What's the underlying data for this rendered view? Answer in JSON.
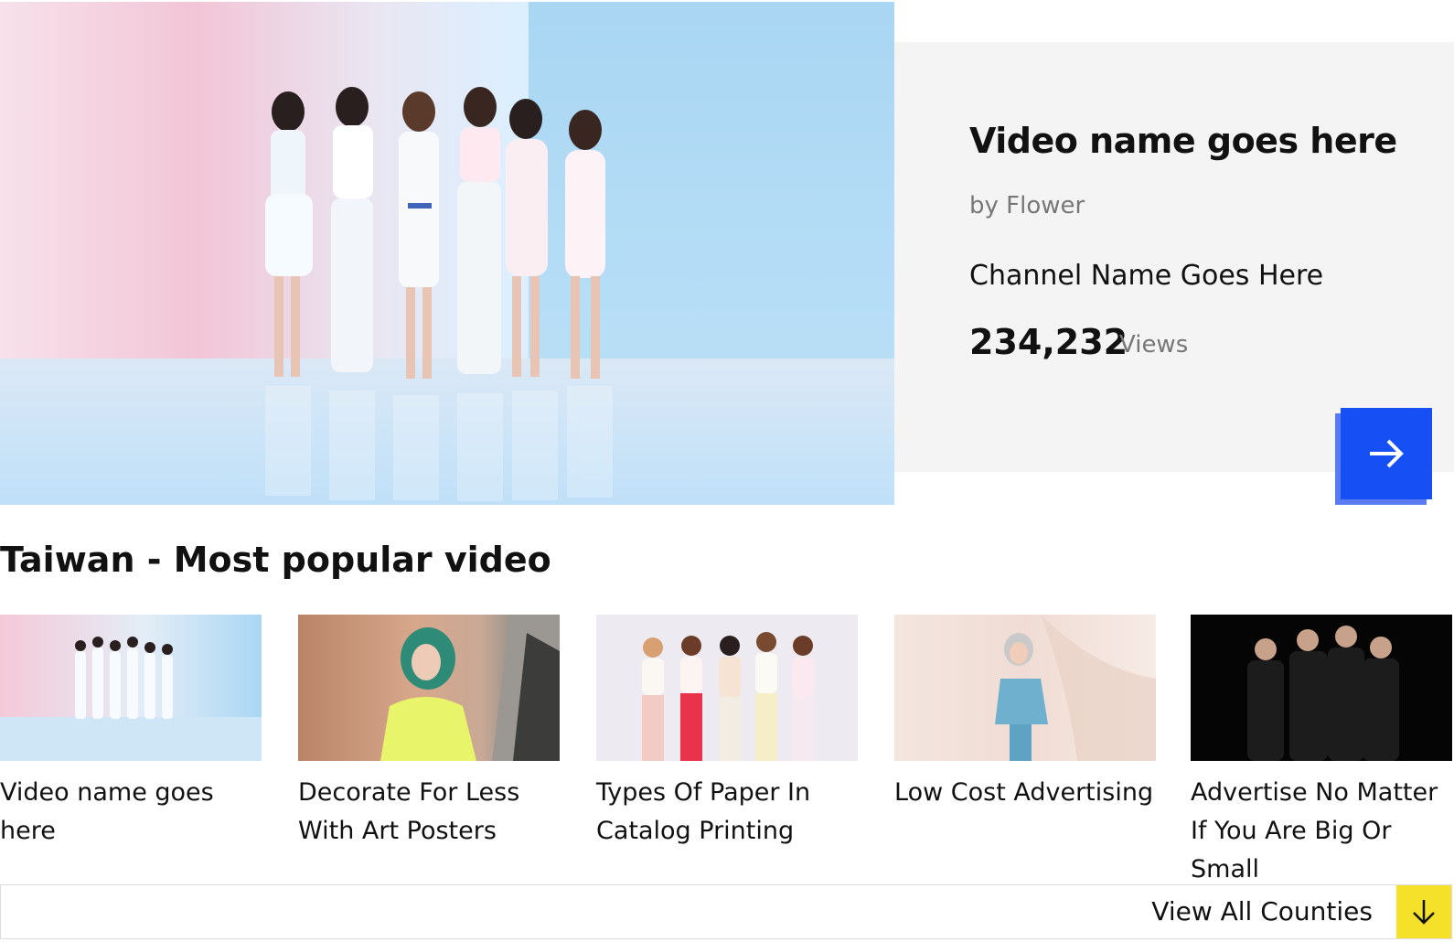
{
  "featured": {
    "title": "Video name goes here",
    "by_line": "by Flower",
    "channel": "Channel Name Goes Here",
    "views_count": "234,232",
    "views_label": "Views",
    "next_icon": "arrow-right-icon",
    "accent_color": "#1650f5"
  },
  "section": {
    "title": "Taiwan  - Most popular video"
  },
  "videos": [
    {
      "title": "Video name goes here"
    },
    {
      "title": "Decorate For Less With Art Posters"
    },
    {
      "title": "Types Of Paper In Catalog Printing"
    },
    {
      "title": "Low Cost Advertising"
    },
    {
      "title": "Advertise No Matter If You Are Big Or Small"
    }
  ],
  "footer": {
    "view_all_label": "View All Counties",
    "view_all_icon": "arrow-down-icon",
    "button_color": "#f5e12a"
  }
}
